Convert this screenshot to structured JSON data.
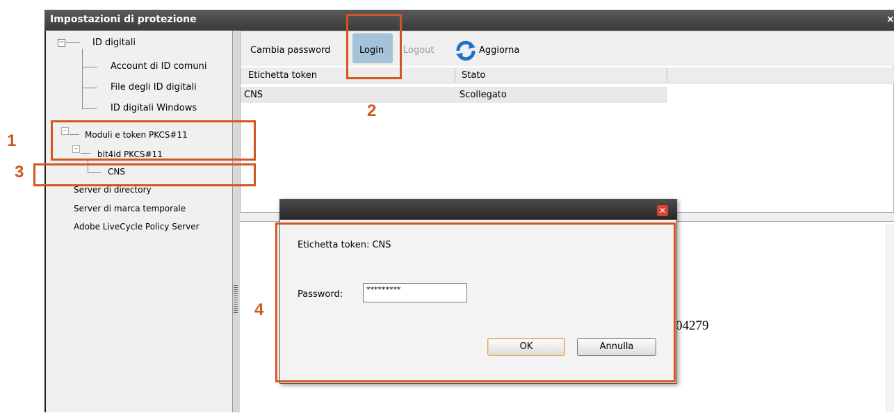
{
  "window": {
    "title": "Impostazioni di protezione",
    "close_glyph": "×"
  },
  "tree": {
    "digital_ids": "ID digitali",
    "shared_id_accounts": "Account di ID comuni",
    "digital_id_files": "File degli ID digitali",
    "windows_digital_ids": "ID digitali Windows",
    "pkcs11_modules": "Moduli e token PKCS#11",
    "bit4id_module": "bit4id PKCS#11",
    "cns_token": "CNS",
    "directory_servers": "Server di directory",
    "timestamp_servers": "Server di marca temporale",
    "livecycle_server": "Adobe LiveCycle Policy Server"
  },
  "toolbar": {
    "change_password": "Cambia password",
    "login": "Login",
    "logout": "Logout",
    "refresh": "Aggiorna",
    "refresh_icon": "refresh-icon"
  },
  "table": {
    "columns": [
      "Etichetta token",
      "Stato"
    ],
    "rows": [
      {
        "label": "CNS",
        "status": "Scollegato"
      }
    ]
  },
  "background_text": "04279",
  "dialog": {
    "token_label": "Etichetta token: CNS",
    "password_label": "Password:",
    "password_value": "*********",
    "ok": "OK",
    "cancel": "Annulla",
    "close_icon": "close-icon"
  },
  "annotations": {
    "n1": "1",
    "n2": "2",
    "n3": "3",
    "n4": "4"
  },
  "colors": {
    "annotation": "#d2561e",
    "login_highlight": "#a6c2d8",
    "dialog_close": "#d9442c"
  }
}
